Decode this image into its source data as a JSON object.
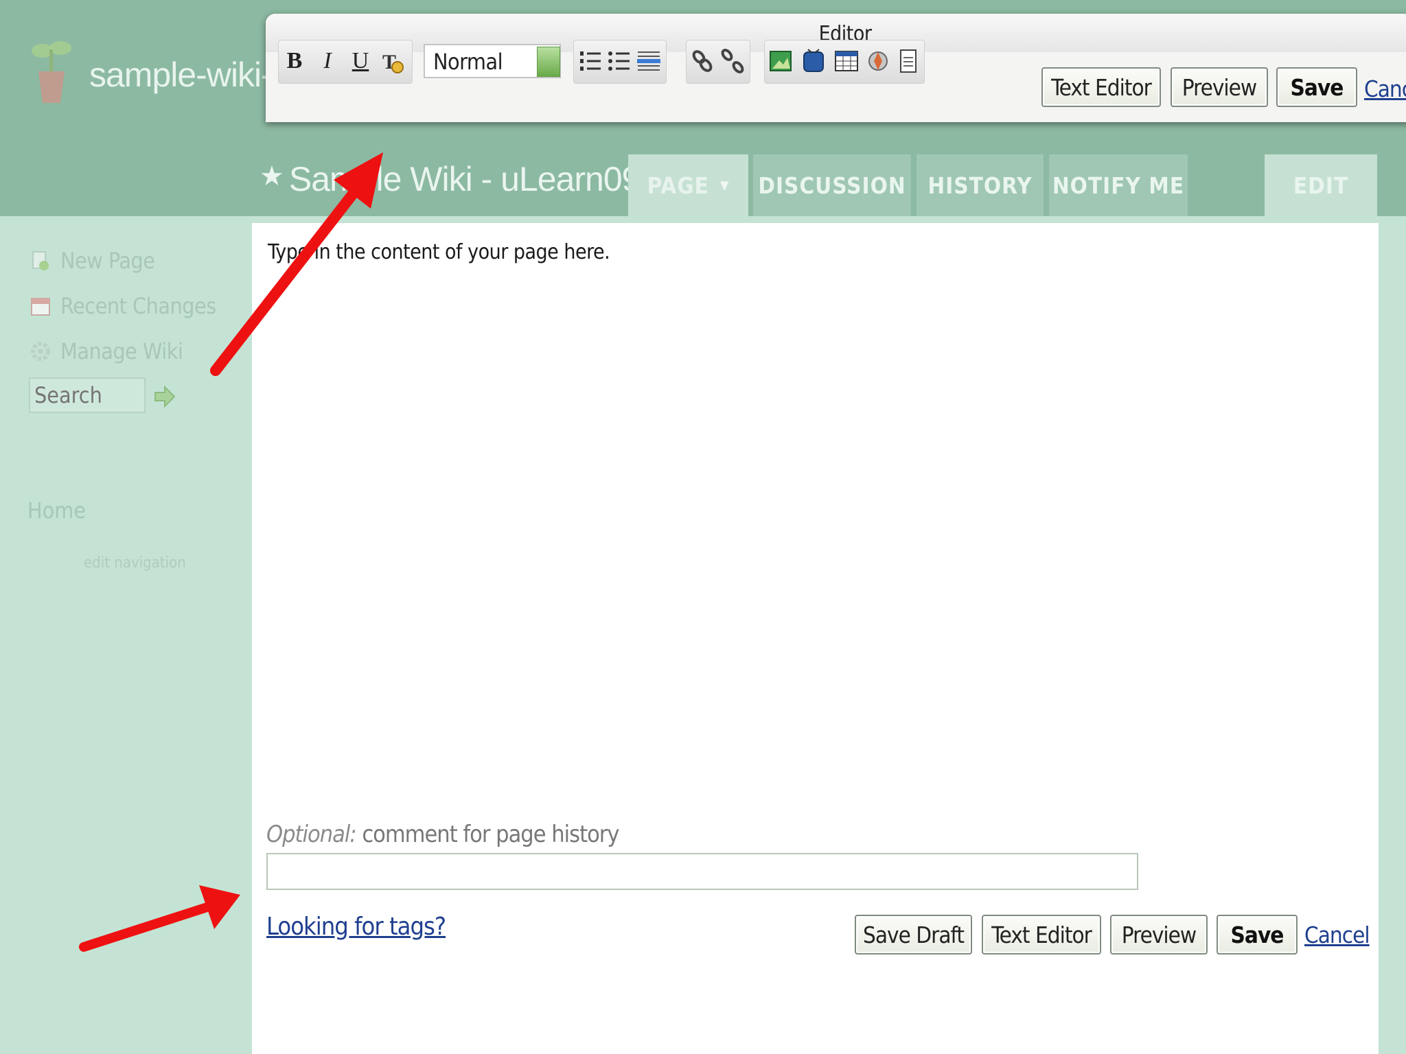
{
  "site": {
    "name": "sample-wiki-ul",
    "wiki_title": "Sample Wiki - uLearn09",
    "title_star": "★"
  },
  "tabs": [
    {
      "label": "PAGE",
      "caret": "▼"
    },
    {
      "label": "DISCUSSION"
    },
    {
      "label": "HISTORY"
    },
    {
      "label": "NOTIFY ME"
    },
    {
      "label": "EDIT"
    }
  ],
  "sidebar": {
    "items": [
      {
        "label": "New Page",
        "icon": "new-page-icon"
      },
      {
        "label": "Recent Changes",
        "icon": "calendar-icon"
      },
      {
        "label": "Manage Wiki",
        "icon": "gear-icon"
      }
    ],
    "search_placeholder": "Search",
    "nav_home": "Home",
    "edit_navigation": "edit navigation"
  },
  "toolbar": {
    "title": "Editor",
    "bold": "B",
    "italic": "I",
    "underline": "U",
    "format_value": "Normal",
    "text_editor": "Text Editor",
    "preview": "Preview",
    "save": "Save",
    "cancel": "Canc"
  },
  "editor": {
    "body_text": "Type in the content of your page here."
  },
  "form": {
    "comment_label_em": "Optional:",
    "comment_label_rest": " comment for page history",
    "comment_value": "",
    "tags_link": "Looking for tags?",
    "save_draft": "Save Draft",
    "text_editor": "Text Editor",
    "preview": "Preview",
    "save": "Save",
    "cancel": "Cancel"
  },
  "colors": {
    "header": "#8cb9a2",
    "sidebar": "#c4e3d4",
    "arrow": "#ee1111",
    "link": "#1f3f8f"
  }
}
